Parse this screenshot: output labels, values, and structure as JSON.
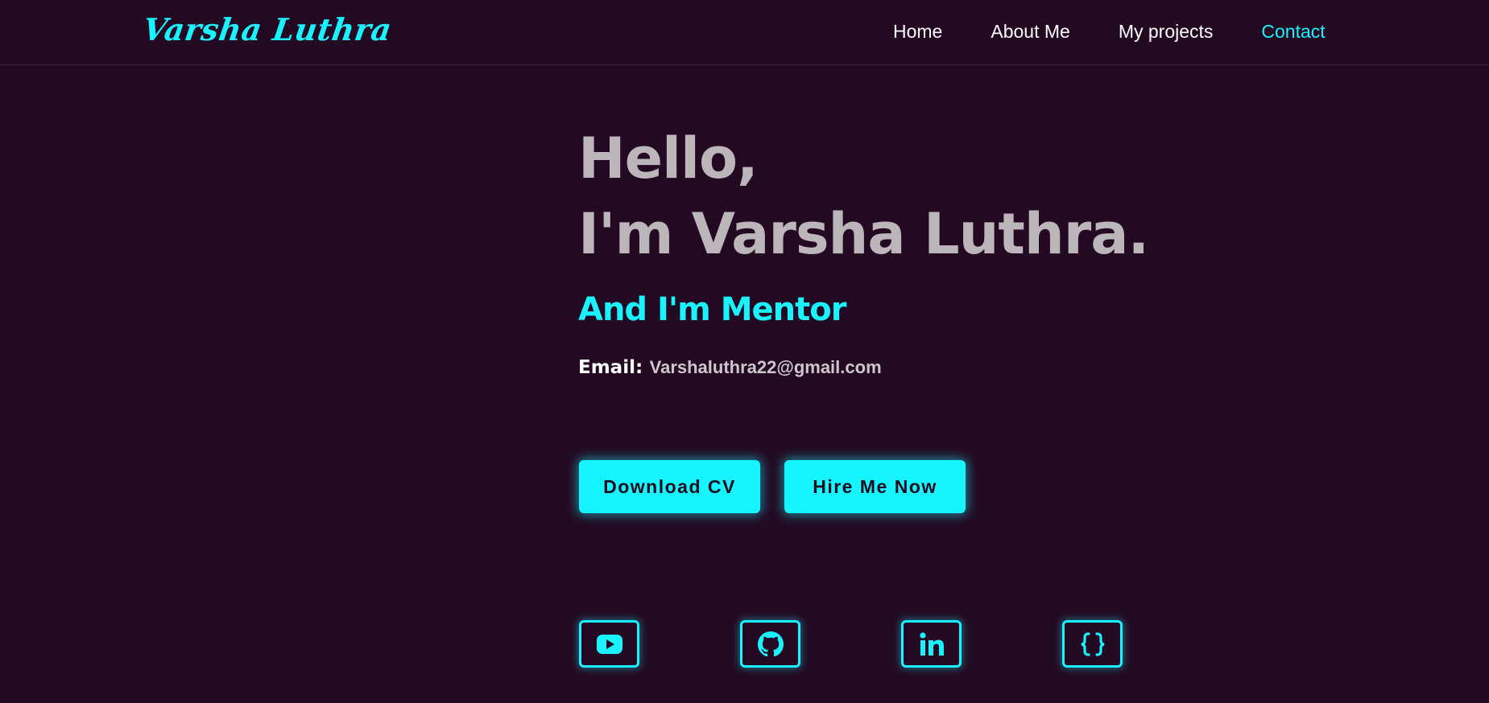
{
  "header": {
    "logo": "Varsha Luthra",
    "nav": [
      {
        "label": "Home",
        "active": false
      },
      {
        "label": "About Me",
        "active": false
      },
      {
        "label": "My projects",
        "active": false
      },
      {
        "label": "Contact",
        "active": true
      }
    ]
  },
  "hero": {
    "greeting": "Hello,",
    "intro": "I'm Varsha Luthra.",
    "role": "And I'm Mentor",
    "email_label": "Email:",
    "email_value": "Varshaluthra22@gmail.com"
  },
  "buttons": {
    "download_label": "Download CV",
    "hire_label": "Hire Me Now"
  },
  "socials": [
    {
      "icon": "youtube-icon"
    },
    {
      "icon": "github-icon"
    },
    {
      "icon": "linkedin-icon"
    },
    {
      "icon": "curly-braces-icon"
    }
  ],
  "colors": {
    "background": "#230a22",
    "accent": "#19f2ff",
    "heading": "#bcb6bb",
    "text": "#ffffff"
  }
}
